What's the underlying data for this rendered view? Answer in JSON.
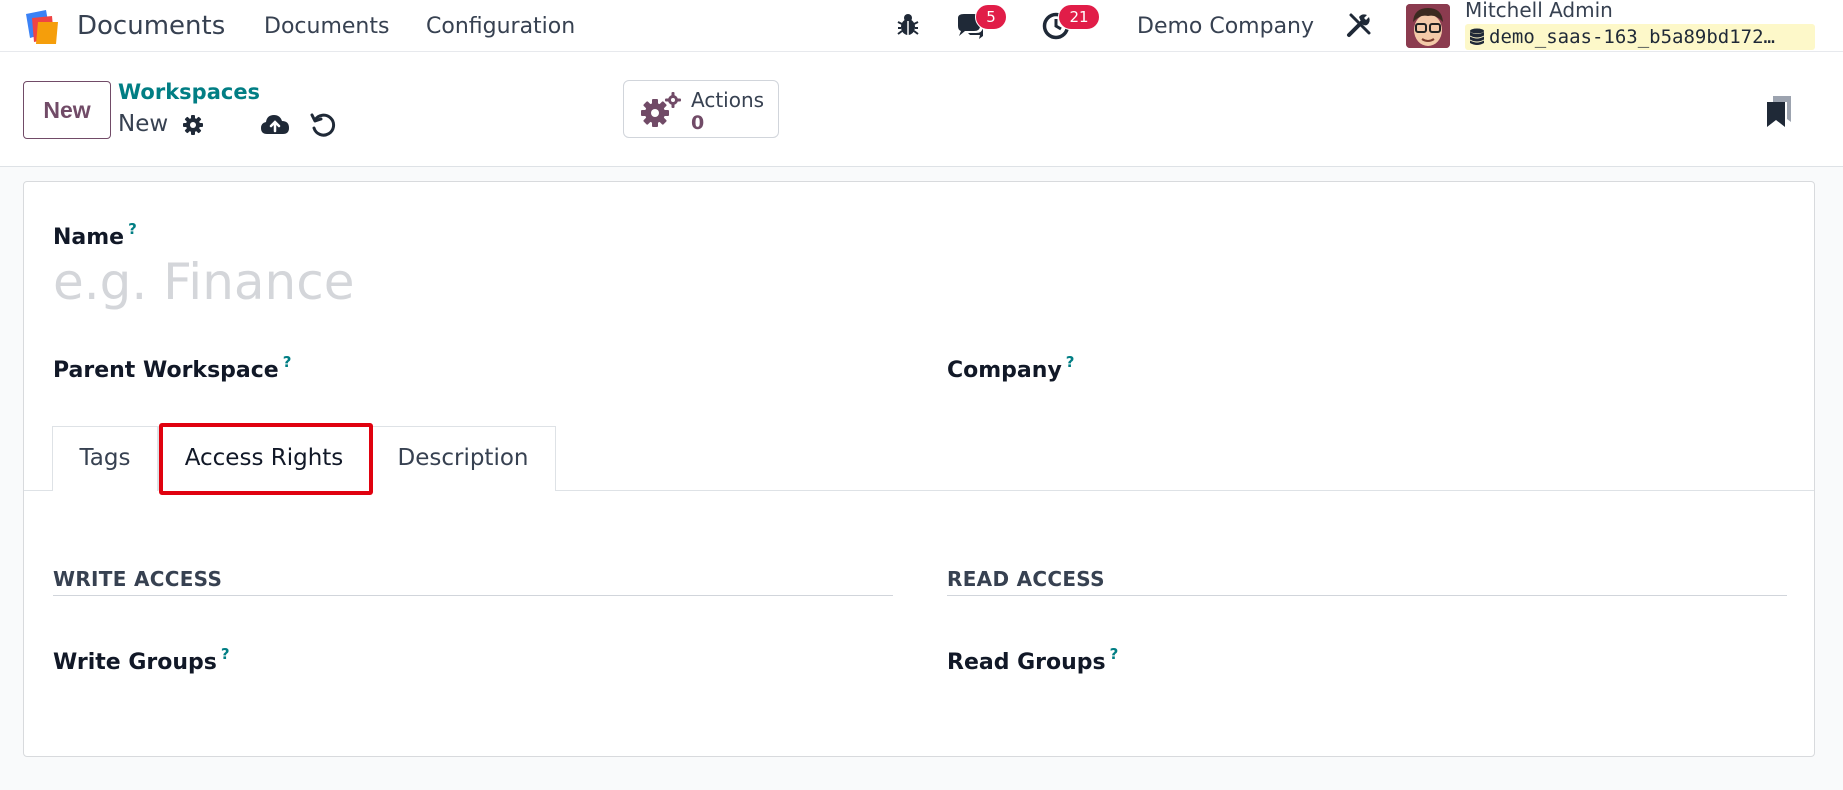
{
  "navbar": {
    "app_name": "Documents",
    "menu": [
      "Documents",
      "Configuration"
    ],
    "messages_count": "5",
    "activities_count": "21",
    "company": "Demo Company",
    "user_name": "Mitchell Admin",
    "database": "demo_saas-163_b5a89bd172…"
  },
  "control_panel": {
    "new_button": "New",
    "breadcrumb": "Workspaces",
    "record_name": "New",
    "actions_label": "Actions",
    "actions_count": "0"
  },
  "form": {
    "name_label": "Name",
    "name_placeholder": "e.g. Finance",
    "name_value": "",
    "parent_label": "Parent Workspace",
    "company_label": "Company",
    "help_mark": "?",
    "tabs": [
      "Tags",
      "Access Rights",
      "Description"
    ],
    "active_tab": "Access Rights",
    "write_section": "WRITE ACCESS",
    "read_section": "READ ACCESS",
    "write_groups_label": "Write Groups",
    "read_groups_label": "Read Groups"
  },
  "colors": {
    "brand": "#714b67",
    "link": "#017e84",
    "badge": "#e11d48",
    "highlight": "#e0010f"
  },
  "icons": [
    "app-logo-icon",
    "bug-icon",
    "chat-icon",
    "clock-icon",
    "tools-icon",
    "database-icon",
    "gear-icon",
    "cloud-upload-icon",
    "undo-icon",
    "gears-icon",
    "bookmark-icon"
  ]
}
